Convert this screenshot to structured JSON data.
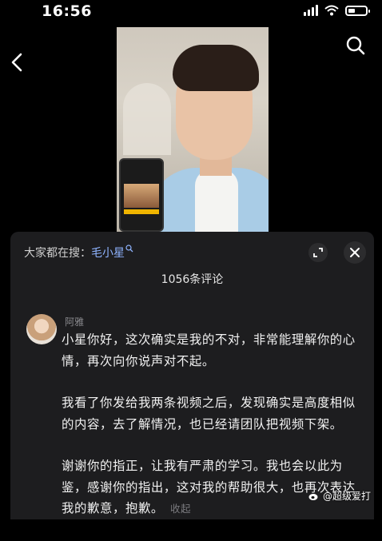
{
  "status_bar": {
    "time": "16:56"
  },
  "icons": {
    "back": "chevron-left-icon",
    "search": "search-icon",
    "expand": "expand-icon",
    "close": "close-icon"
  },
  "comment_panel": {
    "search_hint_prefix": "大家都在搜：",
    "search_term": "毛小星",
    "comment_count": "1056条评论",
    "comment": {
      "username": "阿雅",
      "paragraphs": [
        "小星你好，这次确实是我的不对，非常能理解你的心情，再次向你说声对不起。",
        "我看了你发给我两条视频之后，发现确实是高度相似的内容，去了解情况，也已经请团队把视频下架。",
        "谢谢你的指正，让我有严肃的学习。我也会以此为鉴，感谢你的指出，这对我的帮助很大，也再次表达我的歉意，抱歉。"
      ],
      "collapse_label": "收起"
    }
  },
  "watermark": {
    "text": "@超级爱打"
  },
  "colors": {
    "background": "#000000",
    "panel": "#1d1d1f",
    "search_term": "#8fb4ff"
  }
}
